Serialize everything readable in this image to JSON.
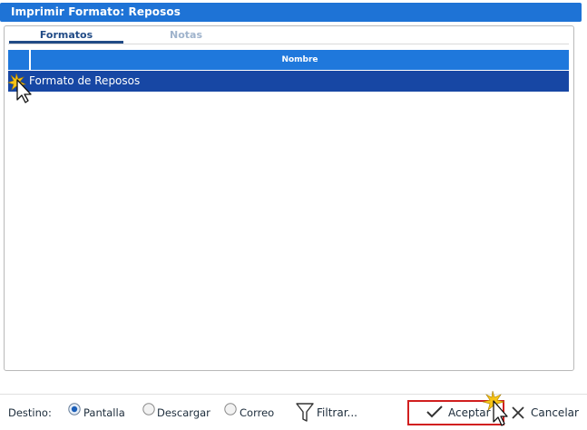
{
  "window": {
    "title": "Imprimir Formato: Reposos"
  },
  "tabs": [
    {
      "label": "Formatos",
      "active": true
    },
    {
      "label": "Notas",
      "active": false
    }
  ],
  "grid": {
    "columns": [
      "Nombre"
    ],
    "rows": [
      {
        "nombre": "Formato de Reposos",
        "selected": true
      }
    ]
  },
  "footer": {
    "destino_label": "Destino:",
    "destinations": [
      {
        "label": "Pantalla",
        "selected": true
      },
      {
        "label": "Descargar",
        "selected": false
      },
      {
        "label": "Correo",
        "selected": false
      }
    ],
    "filter_label": "Filtrar...",
    "accept_label": "Aceptar",
    "cancel_label": "Cancelar"
  },
  "colors": {
    "title_bar": "#1e73d6",
    "grid_header": "#1f78dc",
    "selected_row": "#1747a4",
    "accept_border": "#d11f1f",
    "cursor_burst": "#f7c417"
  },
  "icons": [
    "mouse-pointer-icon",
    "filter-funnel-icon",
    "check-icon",
    "close-x-icon"
  ]
}
